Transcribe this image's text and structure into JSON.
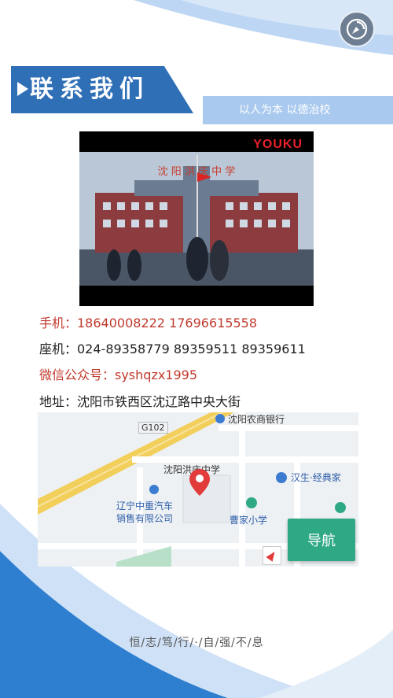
{
  "header": {
    "title": "联系我们",
    "slogan": "以人为本 以德治校"
  },
  "video": {
    "brand": "YOUKU",
    "school_sign": "沈 阳 洪 庆 中 学"
  },
  "contact": {
    "mobile": "手机：18640008222 17696615558",
    "landline": "座机：024-89358779  89359511  89359611",
    "wechat": "微信公众号：syshqzx1995",
    "address": "地址：沈阳市铁西区沈辽路中央大街"
  },
  "map": {
    "road_label": "G102",
    "poi_bank": "沈阳农商银行",
    "poi_school": "沈阳洪庆中学",
    "poi_bookstore": "汉生·经典家",
    "poi_company_line1": "辽宁中重汽车",
    "poi_company_line2": "销售有限公司",
    "poi_primary_school": "曹家小学",
    "nav_button": "导航"
  },
  "footer": {
    "motto": "恒/志/笃/行/·/自/强/不/息"
  },
  "colors": {
    "primary_blue": "#2f6fb6",
    "accent_red": "#c0392b",
    "nav_green": "#2fa885"
  }
}
